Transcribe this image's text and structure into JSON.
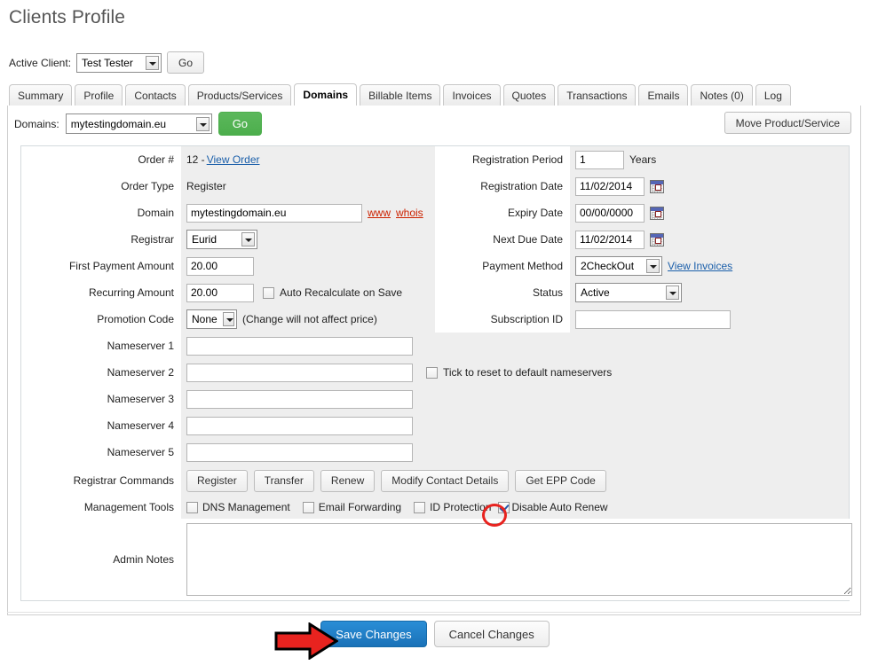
{
  "page": {
    "title": "Clients Profile"
  },
  "active_client": {
    "label": "Active Client:",
    "selected": "Test Tester",
    "go_label": "Go"
  },
  "tabs": [
    {
      "label": "Summary",
      "active": false
    },
    {
      "label": "Profile",
      "active": false
    },
    {
      "label": "Contacts",
      "active": false
    },
    {
      "label": "Products/Services",
      "active": false
    },
    {
      "label": "Domains",
      "active": true
    },
    {
      "label": "Billable Items",
      "active": false
    },
    {
      "label": "Invoices",
      "active": false
    },
    {
      "label": "Quotes",
      "active": false
    },
    {
      "label": "Transactions",
      "active": false
    },
    {
      "label": "Emails",
      "active": false
    },
    {
      "label": "Notes (0)",
      "active": false
    },
    {
      "label": "Log",
      "active": false
    }
  ],
  "domains_bar": {
    "label": "Domains:",
    "selected": "mytestingdomain.eu",
    "go_label": "Go",
    "move_button": "Move Product/Service"
  },
  "left_column": {
    "order_number": {
      "label": "Order #",
      "value": "12 - ",
      "link": "View Order"
    },
    "order_type": {
      "label": "Order Type",
      "value": "Register"
    },
    "domain": {
      "label": "Domain",
      "value": "mytestingdomain.eu",
      "www_link": "www",
      "whois_link": "whois"
    },
    "registrar": {
      "label": "Registrar",
      "value": "Eurid"
    },
    "first_payment_amount": {
      "label": "First Payment Amount",
      "value": "20.00"
    },
    "recurring_amount": {
      "label": "Recurring Amount",
      "value": "20.00",
      "checkbox_label": "Auto Recalculate on Save",
      "checked": false
    },
    "promotion_code": {
      "label": "Promotion Code",
      "value": "None",
      "note": "(Change will not affect price)"
    }
  },
  "right_column": {
    "registration_period": {
      "label": "Registration Period",
      "value": "1",
      "unit": "Years"
    },
    "registration_date": {
      "label": "Registration Date",
      "value": "11/02/2014"
    },
    "expiry_date": {
      "label": "Expiry Date",
      "value": "00/00/0000"
    },
    "next_due_date": {
      "label": "Next Due Date",
      "value": "11/02/2014"
    },
    "payment_method": {
      "label": "Payment Method",
      "value": "2CheckOut",
      "link": "View Invoices"
    },
    "status": {
      "label": "Status",
      "value": "Active"
    },
    "subscription_id": {
      "label": "Subscription ID",
      "value": ""
    }
  },
  "nameservers": {
    "rows": [
      {
        "label": "Nameserver 1",
        "value": ""
      },
      {
        "label": "Nameserver 2",
        "value": ""
      },
      {
        "label": "Nameserver 3",
        "value": ""
      },
      {
        "label": "Nameserver 4",
        "value": ""
      },
      {
        "label": "Nameserver 5",
        "value": ""
      }
    ],
    "reset_checkbox_label": "Tick to reset to default nameservers",
    "reset_checked": false
  },
  "registrar_commands": {
    "label": "Registrar Commands",
    "buttons": [
      "Register",
      "Transfer",
      "Renew",
      "Modify Contact Details",
      "Get EPP Code"
    ]
  },
  "management_tools": {
    "label": "Management Tools",
    "items": [
      {
        "label": "DNS Management",
        "checked": false,
        "highlighted": false
      },
      {
        "label": "Email Forwarding",
        "checked": false,
        "highlighted": false
      },
      {
        "label": "ID Protection",
        "checked": false,
        "highlighted": false
      },
      {
        "label": "Disable Auto Renew",
        "checked": true,
        "highlighted": true
      }
    ]
  },
  "admin_notes": {
    "label": "Admin Notes",
    "value": "",
    "placeholder": ""
  },
  "footer": {
    "save_label": "Save Changes",
    "cancel_label": "Cancel Changes"
  },
  "annotations": {
    "circle": {
      "name": "red-circle-highlight",
      "target": "Disable Auto Renew checkbox",
      "color": "#e8231f"
    },
    "arrow": {
      "name": "red-arrow-pointer",
      "target": "Save Changes button",
      "color": "#e8231f"
    }
  },
  "colors": {
    "accent_green": "#5cb85c",
    "accent_blue": "#1a72b8",
    "annotation_red": "#e8231f",
    "row_bg": "#eeeeee",
    "link": "#1b5faa"
  }
}
